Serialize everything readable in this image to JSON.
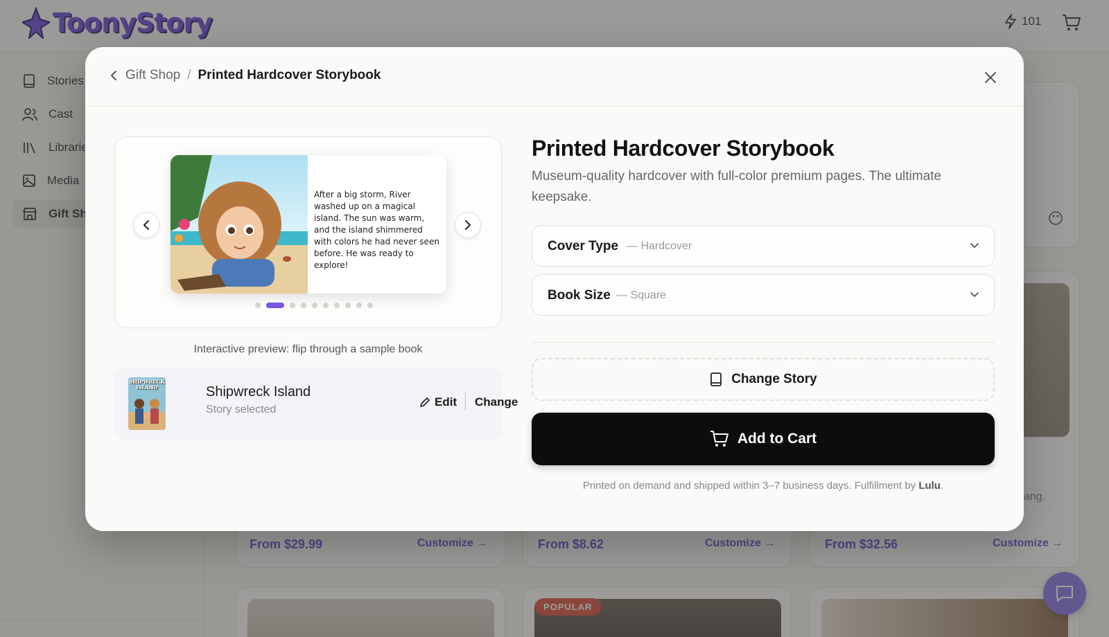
{
  "app": {
    "logo_text": "ToonyStory",
    "credits": "101"
  },
  "sidebar": {
    "items": [
      {
        "label": "Stories"
      },
      {
        "label": "Cast"
      },
      {
        "label": "Libraries"
      },
      {
        "label": "Media"
      },
      {
        "label": "Gift Shop"
      }
    ]
  },
  "background_cards": [
    {
      "price": "From $29.99",
      "cta": "Customize →"
    },
    {
      "price": "From $8.62",
      "cta": "Customize →"
    },
    {
      "price": "From $32.56",
      "cta": "Customize →"
    }
  ],
  "background_text": {
    "peek": "ang.",
    "popular_badge": "POPULAR"
  },
  "modal": {
    "breadcrumb": {
      "parent": "Gift Shop",
      "separator": "/",
      "current": "Printed Hardcover Storybook"
    },
    "preview": {
      "page_text": "After a big storm, River washed up on a magical island. The sun was warm, and the island shimmered with colors he had never seen before. He was ready to explore!",
      "caption": "Interactive preview: flip through a sample book",
      "total_pages": 10,
      "active_page": 1
    },
    "story": {
      "title": "Shipwreck Island",
      "status": "Story selected",
      "edit_label": "Edit",
      "change_label": "Change",
      "thumb_text": "SHIPWRECK ISLAND"
    },
    "product": {
      "title": "Printed Hardcover Storybook",
      "description": "Museum-quality hardcover with full-color premium pages. The ultimate keepsake."
    },
    "options": [
      {
        "label": "Cover Type",
        "value": "— Hardcover"
      },
      {
        "label": "Book Size",
        "value": "— Square"
      }
    ],
    "change_story_label": "Change Story",
    "add_to_cart_label": "Add to Cart",
    "fulfillment": {
      "text": "Printed on demand and shipped within 3–7 business days. Fulfillment by",
      "partner": "Lulu",
      "suffix": "."
    }
  },
  "colors": {
    "accent": "#7557e0",
    "cta_bg": "#0d0d0d",
    "badge": "#d9533d"
  }
}
